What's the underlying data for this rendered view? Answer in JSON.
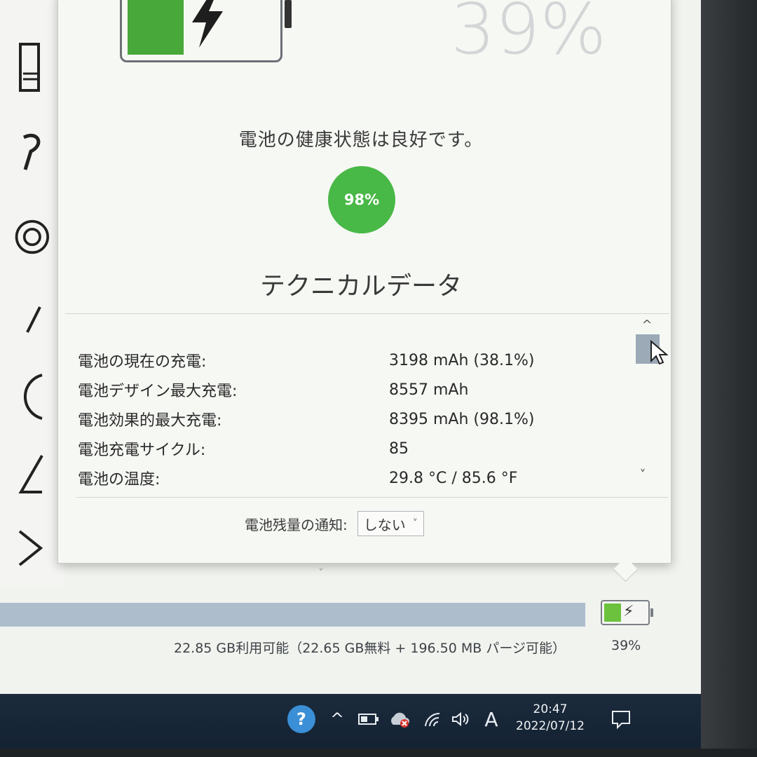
{
  "header": {
    "battery_percent": "39%"
  },
  "health": {
    "status_text": "電池の健康状態は良好です。",
    "percent": "98%"
  },
  "technical": {
    "title": "テクニカルデータ",
    "rows": [
      {
        "label": "電池の現在の充電:",
        "value": "3198 mAh (38.1%)"
      },
      {
        "label": "電池デザイン最大充電:",
        "value": "8557 mAh"
      },
      {
        "label": "電池効果的最大充電:",
        "value": "8395 mAh (98.1%)"
      },
      {
        "label": "電池充電サイクル:",
        "value": "85"
      },
      {
        "label": "電池の温度:",
        "value": "29.8 °C / 85.6 °F"
      }
    ]
  },
  "notification": {
    "label": "電池残量の通知:",
    "selected": "しない"
  },
  "background_app": {
    "storage_text": "22.85 GB利用可能（22.65 GB無料 + 196.50 MB パージ可能）",
    "battery_percent": "39%"
  },
  "taskbar": {
    "time": "20:47",
    "date": "2022/07/12",
    "ime_label": "A"
  },
  "icons": {
    "battery": "battery-charging-icon",
    "help": "help-icon",
    "wifi": "wifi-icon",
    "volume": "volume-icon",
    "notification": "notification-icon"
  },
  "colors": {
    "battery_green": "#48a83a",
    "health_green": "#48b846",
    "taskbar_bg": "#1b2b3c"
  }
}
